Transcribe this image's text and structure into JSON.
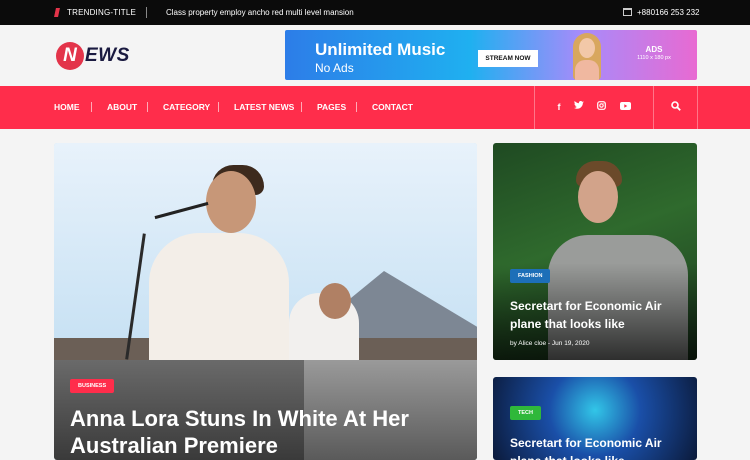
{
  "topbar": {
    "trending_label": "TRENDING-TITLE",
    "headline": "Class property employ ancho red multi level mansion",
    "phone": "+880166 253 232"
  },
  "header": {
    "logo_letter": "N",
    "logo_rest": "EWS",
    "ad": {
      "title": "Unlimited Music",
      "subtitle": "No Ads",
      "button": "STREAM NOW",
      "label": "ADS",
      "size": "1110 x 180 px"
    }
  },
  "nav": {
    "items": [
      "HOME",
      "ABOUT",
      "CATEGORY",
      "LATEST NEWS",
      "PAGES",
      "CONTACT"
    ],
    "social": [
      "facebook-icon",
      "twitter-icon",
      "instagram-icon",
      "youtube-icon"
    ]
  },
  "main_story": {
    "category": "BUSINESS",
    "title": "Anna Lora Stuns In White At Her Australian Premiere"
  },
  "side_stories": [
    {
      "category": "FASHION",
      "title": "Secretart for Economic Air plane that looks like",
      "meta": "by Alice cloe - Jun 19, 2020"
    },
    {
      "category": "TECH",
      "title": "Secretart for Economic Air plane that looks like"
    }
  ],
  "colors": {
    "accent": "#ff2d4b",
    "topbar": "#0b0b0b",
    "fashion_badge": "#1d6fb8",
    "tech_badge": "#2fb83a"
  }
}
